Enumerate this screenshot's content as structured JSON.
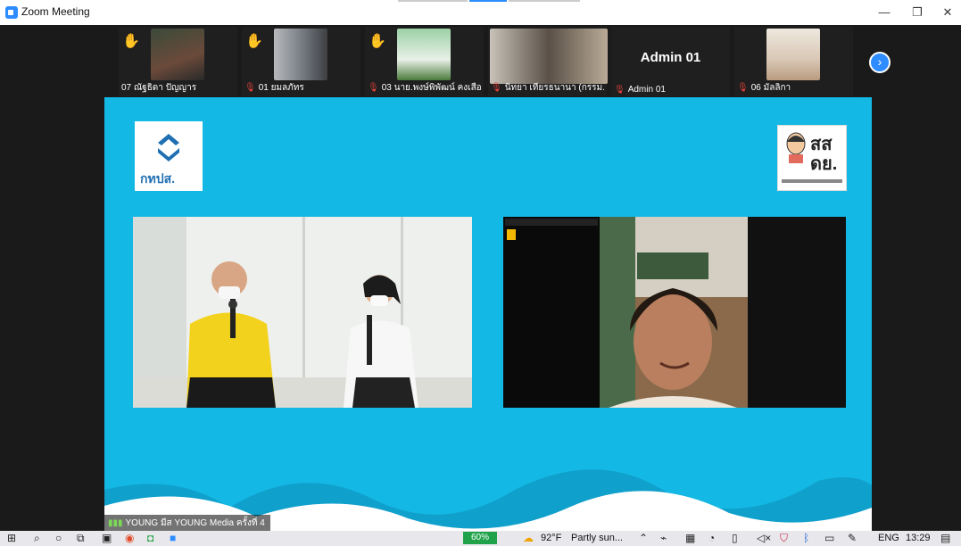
{
  "window": {
    "title": "Zoom Meeting",
    "minimize": "—",
    "restore": "❐",
    "close": "✕"
  },
  "participants": [
    {
      "name": "07 ณัฐธิดา ปัญญาร",
      "hand": "✋",
      "muted": false,
      "photo_color": "#6b4a3a"
    },
    {
      "name": "01 ยมลภัทร",
      "hand": "✋",
      "muted": true,
      "photo_color": "#7a7f86"
    },
    {
      "name": "03 นาย.พงษ์พิพัฒน์ คงเสือ",
      "hand": "✋",
      "muted": true,
      "photo_color": "#8fbf8f"
    },
    {
      "name": "นิทยา เทียรธนานา (กรรม...",
      "hand": "",
      "muted": true,
      "photo_color": "#5a5048"
    },
    {
      "name": "Admin 01",
      "display": "Admin 01",
      "hand": "",
      "muted": true
    },
    {
      "name": "06 มัลลิกา",
      "hand": "",
      "muted": true,
      "photo_color": "#d8c7b5"
    }
  ],
  "next_page_icon": "chevron-right-icon",
  "share": {
    "background": "#14b8e4",
    "logo_left_text": "กทปส.",
    "logo_right_line1": "สส",
    "logo_right_line2": "ดย."
  },
  "active_label": {
    "signal_icon": "signal-bars-icon",
    "text": "YOUNG มีส YOUNG Media ครั้งที่ 4"
  },
  "taskbar": {
    "battery": "60%",
    "weather_temp": "92°F",
    "weather_text": "Partly sun...",
    "language": "ENG",
    "time": "13:29"
  }
}
